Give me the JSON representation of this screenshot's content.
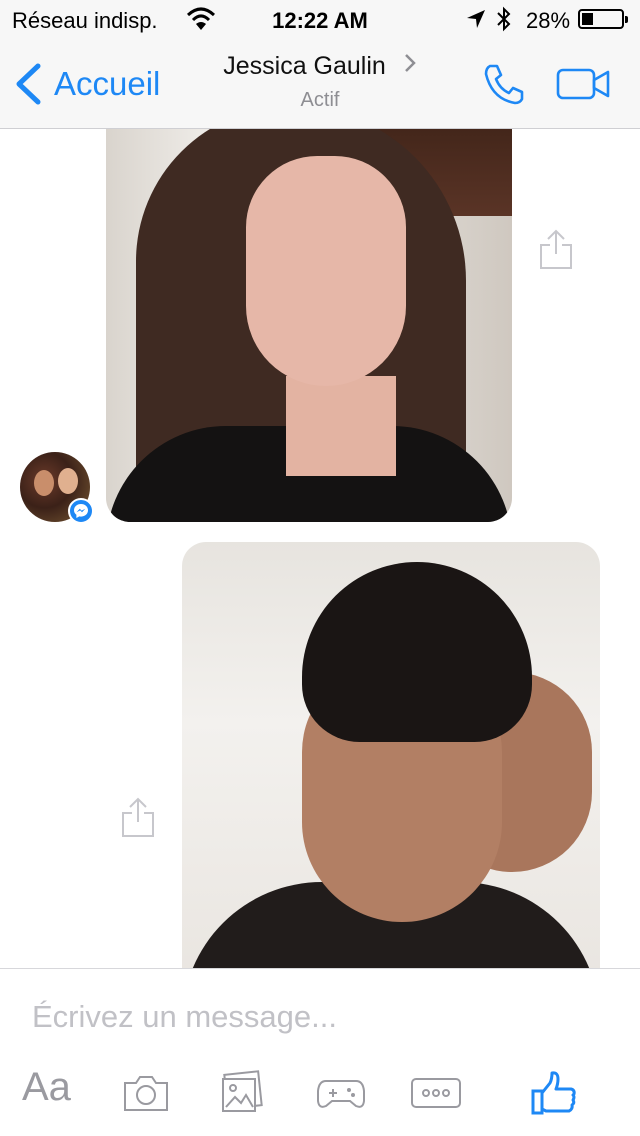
{
  "status_bar": {
    "carrier": "Réseau indisp.",
    "time": "12:22 AM",
    "battery_percent": "28%",
    "battery_level": 0.28,
    "icons": [
      "wifi-icon",
      "location-arrow-icon",
      "bluetooth-icon",
      "battery-icon"
    ]
  },
  "nav": {
    "back_label": "Accueil",
    "title": "Jessica Gaulin",
    "subtitle": "Actif",
    "accent_color": "#1e88f5",
    "icons": [
      "chevron-left-icon",
      "chevron-right-icon",
      "phone-icon",
      "video-camera-icon"
    ]
  },
  "messages": [
    {
      "type": "photo",
      "sender": "contact",
      "description": "selfie-woman"
    },
    {
      "type": "photo",
      "sender": "me",
      "description": "selfie-man"
    }
  ],
  "composer": {
    "placeholder": "Écrivez un message...",
    "aa_label": "Aa",
    "icons": [
      "camera-icon",
      "gallery-icon",
      "game-controller-icon",
      "more-icon",
      "like-icon"
    ]
  }
}
